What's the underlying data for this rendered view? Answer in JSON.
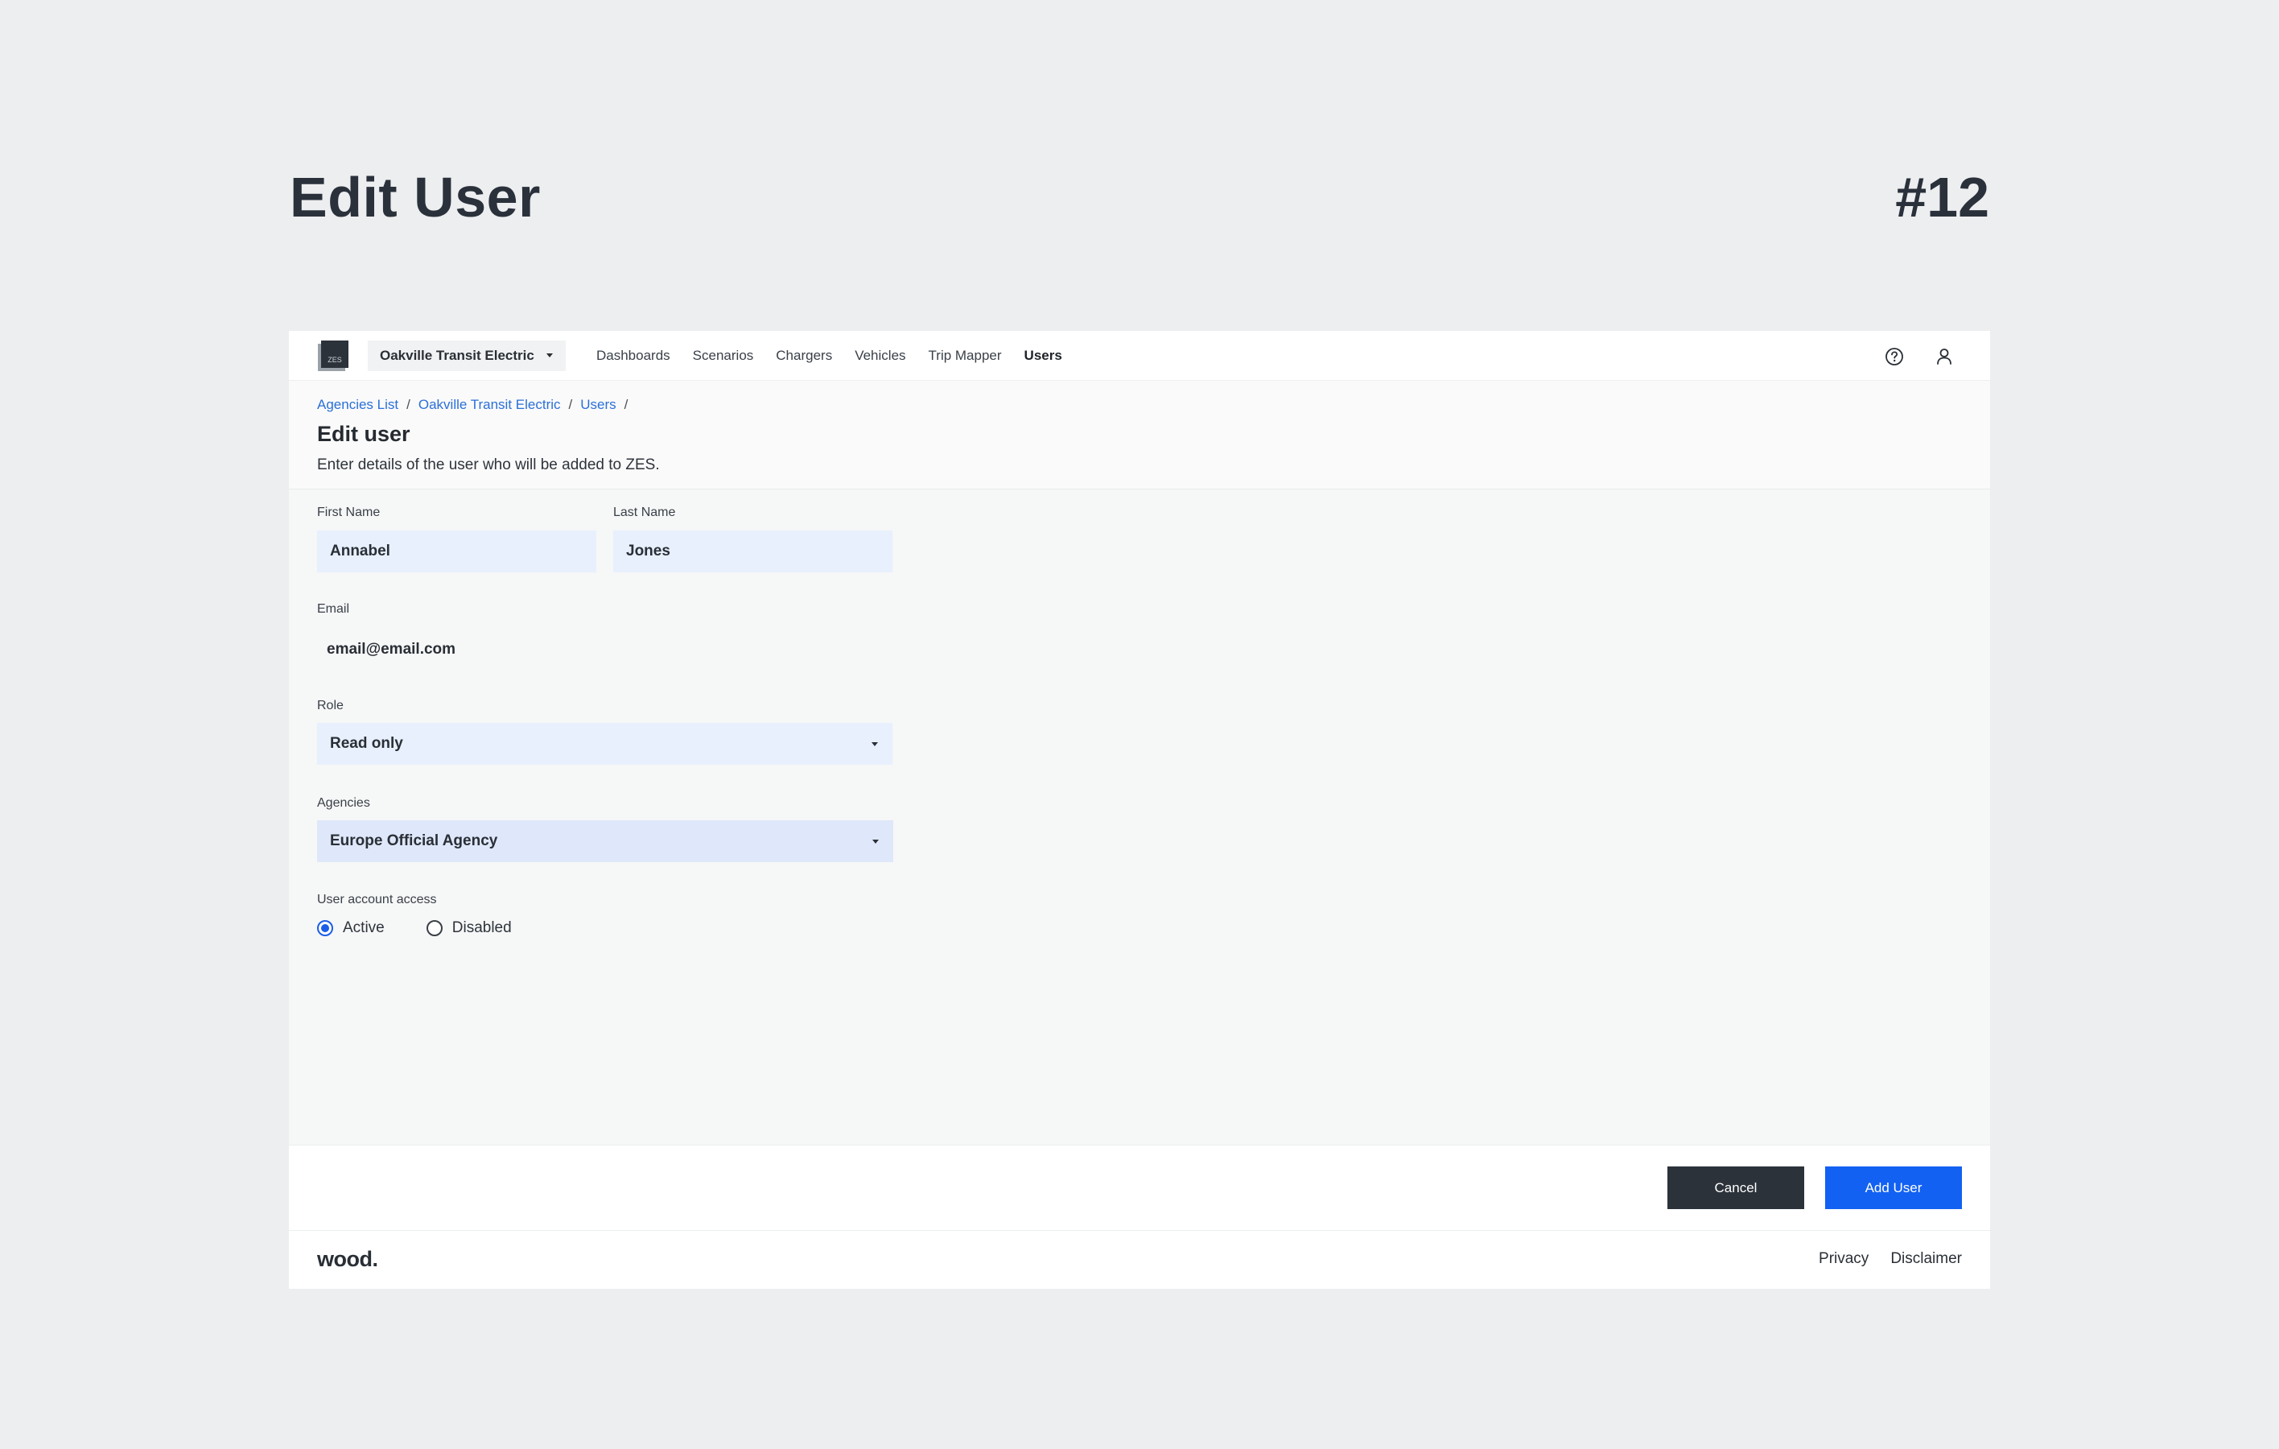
{
  "slide": {
    "title": "Edit User",
    "number": "#12"
  },
  "logo": {
    "text": "ZES"
  },
  "topnav": {
    "agency": "Oakville Transit Electric",
    "links": [
      "Dashboards",
      "Scenarios",
      "Chargers",
      "Vehicles",
      "Trip Mapper",
      "Users"
    ],
    "active": "Users"
  },
  "breadcrumb": [
    "Agencies List",
    "Oakville Transit Electric",
    "Users"
  ],
  "header": {
    "title": "Edit user",
    "description": "Enter details of the user who will be added to ZES."
  },
  "form": {
    "first_name": {
      "label": "First Name",
      "value": "Annabel"
    },
    "last_name": {
      "label": "Last Name",
      "value": "Jones"
    },
    "email": {
      "label": "Email",
      "value": "email@email.com"
    },
    "role": {
      "label": "Role",
      "value": "Read only"
    },
    "agencies": {
      "label": "Agencies",
      "value": "Europe Official Agency"
    },
    "access": {
      "label": "User account access",
      "options": [
        "Active",
        "Disabled"
      ],
      "selected": "Active"
    }
  },
  "actions": {
    "cancel": "Cancel",
    "add": "Add User"
  },
  "footer": {
    "brand": "wood.",
    "links": [
      "Privacy",
      "Disclaimer"
    ]
  },
  "colors": {
    "primary": "#1261f2",
    "dark": "#2c323a",
    "link": "#2b6fd8",
    "input_bg": "#e8f0fd"
  }
}
